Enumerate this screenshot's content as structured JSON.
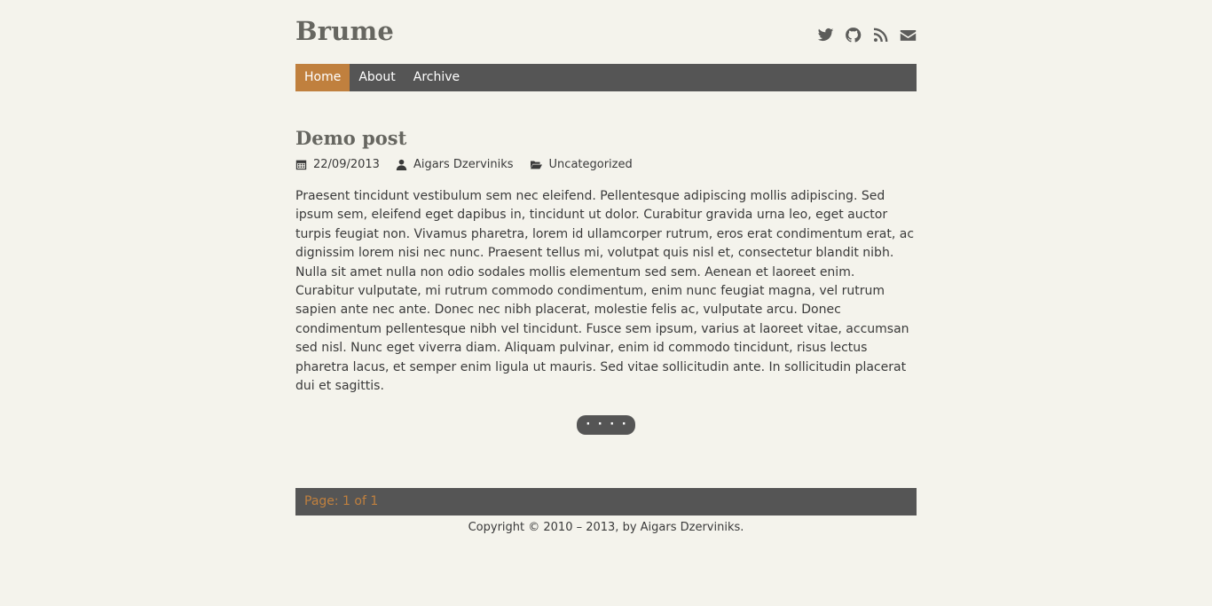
{
  "site": {
    "title": "Brume"
  },
  "social": [
    "twitter-icon",
    "github-icon",
    "rss-icon",
    "envelope-icon"
  ],
  "nav": {
    "items": [
      {
        "label": "Home",
        "active": true
      },
      {
        "label": "About",
        "active": false
      },
      {
        "label": "Archive",
        "active": false
      }
    ]
  },
  "post": {
    "title": "Demo post",
    "date": "22/09/2013",
    "author": "Aigars Dzerviniks",
    "category": "Uncategorized",
    "body": "Praesent tincidunt vestibulum sem nec eleifend. Pellentesque adipiscing mollis adipiscing. Sed ipsum sem, eleifend eget dapibus in, tincidunt ut dolor. Curabitur gravida urna leo, eget auctor turpis feugiat non. Vivamus pharetra, lorem id ullamcorper rutrum, eros erat condimentum erat, ac dignissim lorem nisi nec nunc. Praesent tellus mi, volutpat quis nisl et, consectetur blandit nibh. Nulla sit amet nulla non odio sodales mollis elementum sed sem. Aenean et laoreet enim. Curabitur vulputate, mi rutrum commodo condimentum, enim nunc feugiat magna, vel rutrum sapien ante nec ante. Donec nec nibh placerat, molestie felis ac, vulputate arcu. Donec condimentum pellentesque nibh vel tincidunt. Fusce sem ipsum, varius at laoreet vitae, accumsan sed nisl. Nunc eget viverra diam. Aliquam pulvinar, enim id commodo tincidunt, risus lectus pharetra lacus, et semper enim ligula ut mauris. Sed vitae sollicitudin ante. In sollicitudin placerat dui et sagittis.",
    "more_label": "· · · ·"
  },
  "pager": {
    "text": "Page: 1 of 1"
  },
  "footer": {
    "text": "Copyright © 2010 – 2013, by Aigars Dzerviniks."
  },
  "colors": {
    "accent": "#c0803e",
    "bar": "#555555",
    "background": "#f4f3ec"
  }
}
